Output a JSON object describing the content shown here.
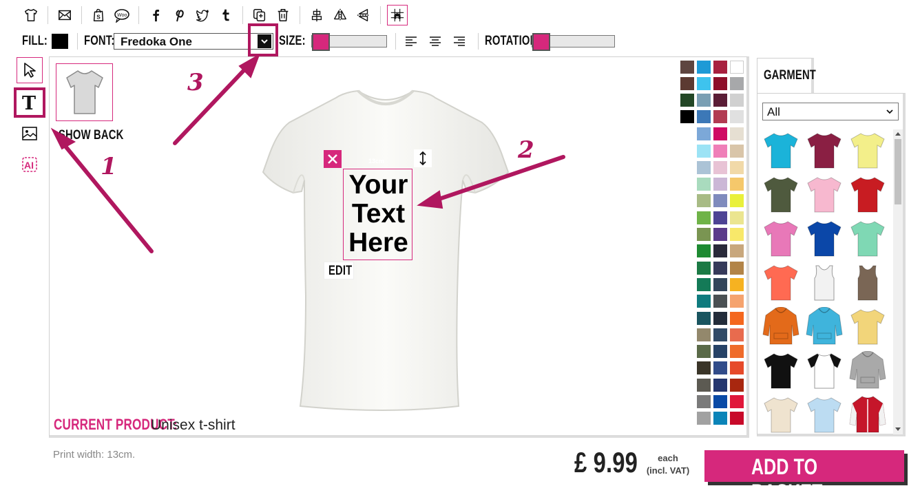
{
  "toolbar": {
    "fill_label": "FILL:",
    "fill_color": "#000000",
    "font_label": "FONT:",
    "font_value": "Fredoka One",
    "size_label": "SIZE:",
    "rotation_label": "ROTATION:",
    "size_level": 0,
    "rotation_level": 0
  },
  "canvas": {
    "show_back_label": "SHOW BACK",
    "text_lines": [
      "Your",
      "Text",
      "Here"
    ],
    "print_measure": "13cm",
    "edit_label": "EDIT",
    "current_product_label": "CURRENT PRODUCT:",
    "current_product_value": "Unisex t-shirt"
  },
  "annotations": [
    "1",
    "2",
    "3"
  ],
  "palette_colors": [
    "#5e4540",
    "#1e9ad6",
    "#a8203f",
    "#ffffff",
    "#5c3a32",
    "#3ec3ee",
    "#8e0f2a",
    "#a7a8aa",
    "#234726",
    "#7a9fb3",
    "#5a1d36",
    "#d0d0d0",
    "#000000",
    "#3c78b7",
    "#b23b52",
    "#e0e0e0",
    "#7ca8d8",
    "#cf0a64",
    "#e6dfd2",
    "#9ce3f5",
    "#ef7fb8",
    "#d9c5a9",
    "#abc3d6",
    "#e8c3d5",
    "#f1d9a8",
    "#a9dbbe",
    "#cbb7d6",
    "#f5c86b",
    "#a8bb85",
    "#7f8bbd",
    "#e9f03a",
    "#6fb348",
    "#4d4394",
    "#ebe590",
    "#7a9552",
    "#5a3a8a",
    "#f8e86a",
    "#1e8a32",
    "#2a2a3a",
    "#c8a77d",
    "#1c7a45",
    "#363a5a",
    "#b28448",
    "#147a57",
    "#33455a",
    "#f6b221",
    "#0f7b7e",
    "#4a5053",
    "#f5a36e",
    "#1a5560",
    "#232c3a",
    "#f4671e",
    "#93886c",
    "#314a66",
    "#e86b4e",
    "#5a6a48",
    "#264266",
    "#ef6b2a",
    "#3a3528",
    "#314c8a",
    "#e64a2a",
    "#5c5a52",
    "#24366e",
    "#a8270f",
    "#7a7a7a",
    "#0a4aa6",
    "#e0173a",
    "#a1a1a1",
    "#0b84b8",
    "#c80a2a"
  ],
  "garment_panel": {
    "tab_label": "GARMENT",
    "filter_value": "All",
    "items": [
      {
        "name": "tee-turquoise",
        "color": "#1bb3d9",
        "style": "tee"
      },
      {
        "name": "tee-maroon",
        "color": "#8a1f43",
        "style": "tee"
      },
      {
        "name": "tee-yellow",
        "color": "#f3ef8a",
        "style": "tee"
      },
      {
        "name": "tee-olive",
        "color": "#4f5a3e",
        "style": "tee"
      },
      {
        "name": "tee-light-pink",
        "color": "#f7b8cf",
        "style": "tee"
      },
      {
        "name": "tee-red",
        "color": "#c81c22",
        "style": "tee"
      },
      {
        "name": "tee-fuchsia",
        "color": "#e878b8",
        "style": "tee"
      },
      {
        "name": "tee-royal-blue",
        "color": "#0b47a8",
        "style": "tee"
      },
      {
        "name": "tee-mint",
        "color": "#7fd8b4",
        "style": "tee"
      },
      {
        "name": "tee-coral",
        "color": "#ff6a52",
        "style": "tee"
      },
      {
        "name": "vest-white",
        "color": "#f2f2f2",
        "style": "vest"
      },
      {
        "name": "vest-brown",
        "color": "#7a6655",
        "style": "vest"
      },
      {
        "name": "hoodie-orange",
        "color": "#e36a1a",
        "style": "hoodie"
      },
      {
        "name": "hoodie-blue",
        "color": "#3fb4dc",
        "style": "hoodie"
      },
      {
        "name": "tee-tie-dye",
        "color": "#f2d57a",
        "style": "tee"
      },
      {
        "name": "tee-black",
        "color": "#111111",
        "style": "tee"
      },
      {
        "name": "raglan-black-white",
        "color": "#ffffff",
        "style": "raglan"
      },
      {
        "name": "hoodie-grey",
        "color": "#a9a9a9",
        "style": "hoodie"
      },
      {
        "name": "tee-natural",
        "color": "#efe3cf",
        "style": "tee"
      },
      {
        "name": "tee-light-blue",
        "color": "#bcdcf2",
        "style": "tee"
      },
      {
        "name": "jacket-red-white",
        "color": "#c5162a",
        "style": "jacket"
      }
    ]
  },
  "footer": {
    "print_width": "Print width: 13cm.",
    "price": "£ 9.99",
    "each_label": "each",
    "vat_label": "(incl. VAT)",
    "add_to_basket": "ADD TO BASKET"
  },
  "colors": {
    "accent": "#d6287c",
    "annotation": "#b0175f"
  }
}
